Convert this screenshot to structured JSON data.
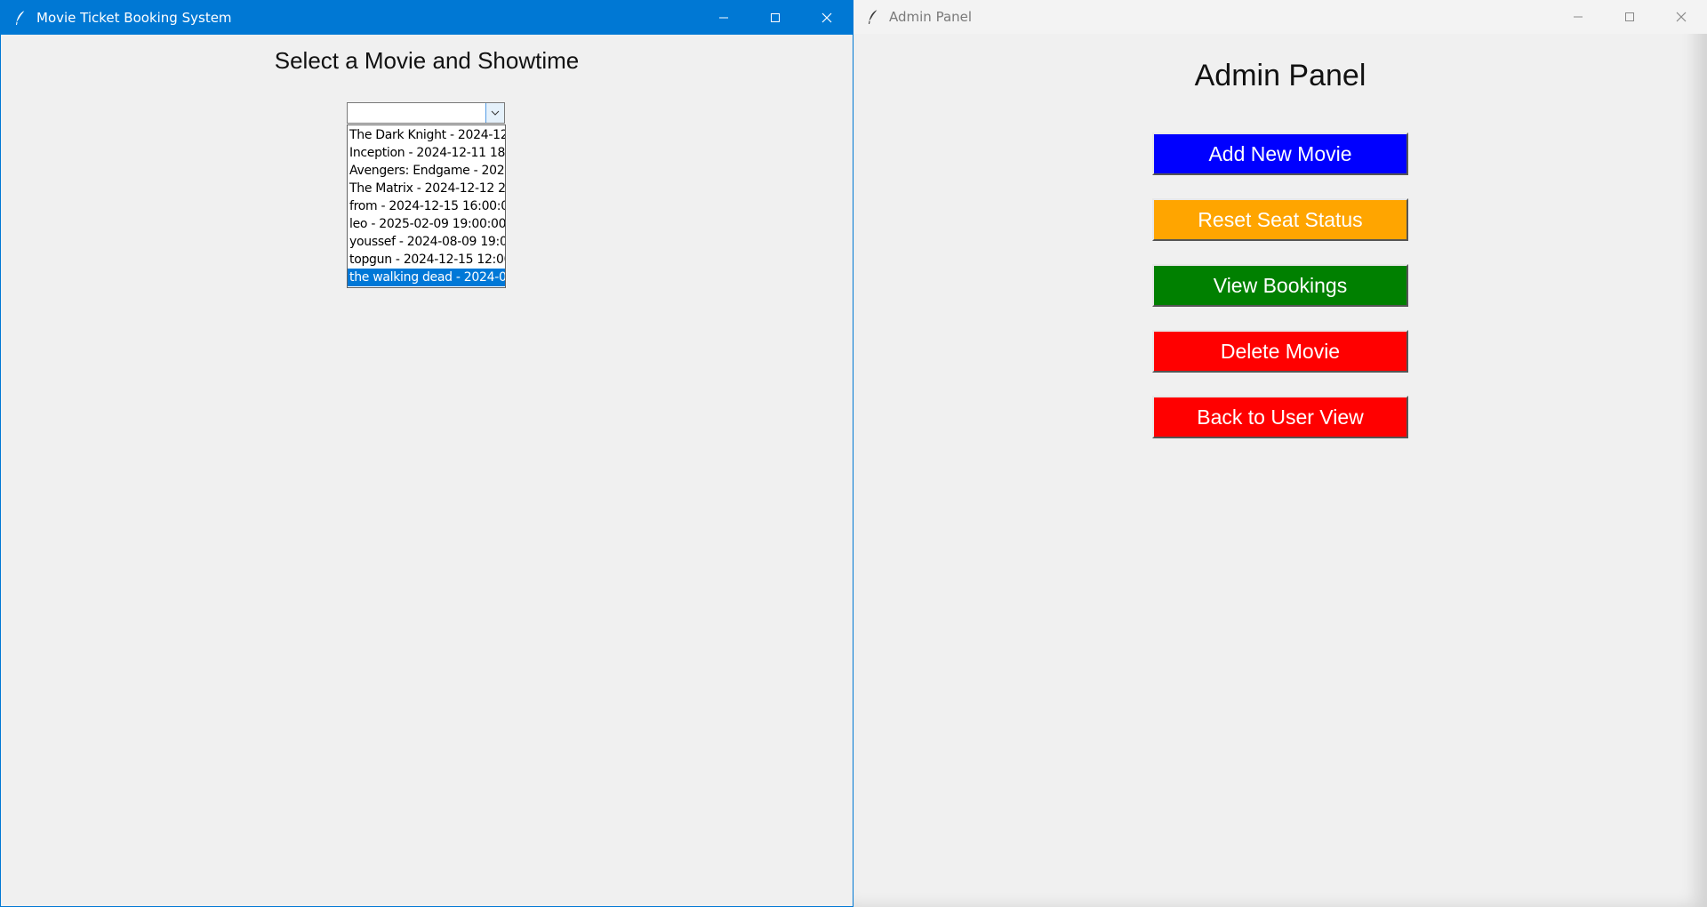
{
  "left_window": {
    "title": "Movie Ticket Booking System",
    "heading": "Select a Movie and Showtime",
    "combobox": {
      "value": ""
    },
    "showtimes": [
      "The Dark Knight - 2024-12-",
      "Inception - 2024-12-11 18:",
      "Avengers: Endgame - 2024",
      "The Matrix - 2024-12-12 21",
      "from  - 2024-12-15 16:00:0",
      "leo - 2025-02-09 19:00:00",
      "youssef - 2024-08-09 19:00",
      "topgun - 2024-12-15 12:00",
      "the walking dead - 2024-0"
    ],
    "selected_index": 8
  },
  "right_window": {
    "title": "Admin Panel",
    "heading": "Admin Panel",
    "buttons": [
      {
        "label": "Add New Movie",
        "color": "#0000ff"
      },
      {
        "label": "Reset Seat Status",
        "color": "#ffa500"
      },
      {
        "label": "View Bookings",
        "color": "#008000"
      },
      {
        "label": "Delete Movie",
        "color": "#ff0000"
      },
      {
        "label": "Back to User View",
        "color": "#ff0000"
      }
    ]
  },
  "icons": {
    "app": "feather-icon",
    "minimize": "minimize-icon",
    "maximize": "maximize-icon",
    "close": "close-icon",
    "dropdown": "chevron-down-icon"
  },
  "colors": {
    "accent": "#0078d4",
    "selection": "#0078d7"
  }
}
